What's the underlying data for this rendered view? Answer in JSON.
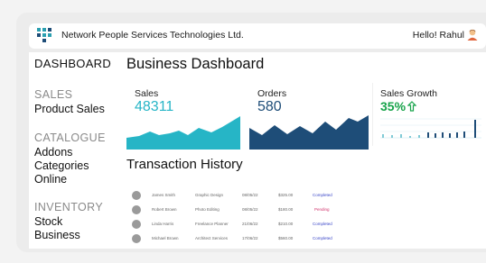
{
  "header": {
    "company": "Network People Services Technologies Ltd.",
    "greeting": "Hello! Rahul"
  },
  "sidebar": {
    "title": "DASHBOARD",
    "sections": [
      {
        "heading": "SALES",
        "items": [
          "Product Sales"
        ]
      },
      {
        "heading": "CATALOGUE",
        "items": [
          "Addons",
          "Categories",
          "Online"
        ]
      },
      {
        "heading": "INVENTORY",
        "items": [
          "Stock",
          "Business"
        ]
      }
    ]
  },
  "main": {
    "title": "Business Dashboard",
    "kpis": {
      "sales": {
        "label": "Sales",
        "value": "48311",
        "color": "#26b5c6"
      },
      "orders": {
        "label": "Orders",
        "value": "580",
        "color": "#1e4d78"
      },
      "growth": {
        "label": "Sales Growth",
        "value": "35%",
        "color": "#17a34a"
      }
    },
    "transactions_title": "Transaction History",
    "transactions": [
      {
        "name": "James Smith",
        "item": "Graphic Design",
        "date": "08/05/22",
        "amount": "$325.00",
        "status": "Completed"
      },
      {
        "name": "Robert Brown",
        "item": "Photo Editing",
        "date": "08/05/22",
        "amount": "$180.00",
        "status": "Pending"
      },
      {
        "name": "Linda Harris",
        "item": "Freelance Planner",
        "date": "21/06/22",
        "amount": "$210.00",
        "status": "Completed"
      },
      {
        "name": "Michael Brown",
        "item": "Architect Services",
        "date": "17/06/22",
        "amount": "$560.00",
        "status": "Completed"
      }
    ]
  },
  "icons": {
    "logo": "grid-logo-icon",
    "avatar": "user-avatar-icon",
    "growth_arrow": "arrow-up-icon"
  },
  "colors": {
    "accent_teal": "#26b5c6",
    "accent_navy": "#1e4d78",
    "growth_green": "#17a34a",
    "completed": "#3a46c8",
    "pending": "#d0336c"
  }
}
